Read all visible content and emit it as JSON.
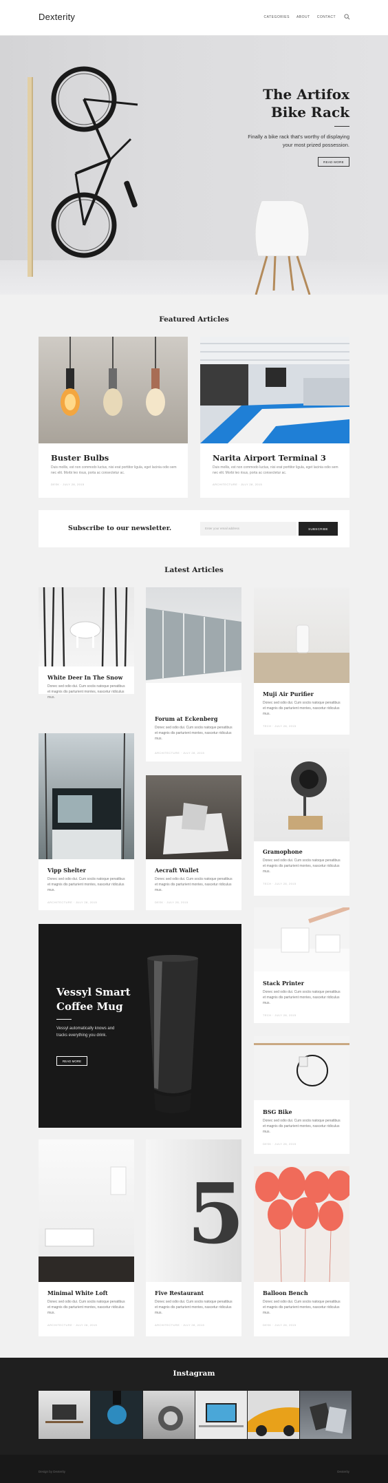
{
  "header": {
    "logo": "Dexterity",
    "nav": [
      "CATEGORIES",
      "ABOUT",
      "CONTACT"
    ]
  },
  "hero": {
    "title_line1": "The Artifox",
    "title_line2": "Bike Rack",
    "subtitle": "Finally a bike rack that's worthy of displaying your most prized possession.",
    "button": "READ MORE"
  },
  "featured": {
    "title": "Featured Articles",
    "cards": [
      {
        "title": "Buster Bulbs",
        "excerpt": "Duis mollis, est non commodo luctus, nisi erat porttitor ligula, eget lacinia odio sem nec elit. Morbi leo risus, porta ac consectetur ac.",
        "meta": "DESK  ·  JULY 28, 2015"
      },
      {
        "title": "Narita Airport Terminal 3",
        "excerpt": "Duis mollis, est non commodo luctus, nisi erat porttitor ligula, eget lacinia odio sem nec elit. Morbi leo risus, porta ac consectetur ac.",
        "meta": "ARCHITECTURE  ·  JULY 28, 2015"
      }
    ]
  },
  "newsletter": {
    "title": "Subscribe to our newsletter.",
    "placeholder": "Enter your email address",
    "button": "SUBSCRIBE"
  },
  "latest": {
    "title": "Latest Articles",
    "excerpt": "Donec sed odio dui. Cum sociis natoque penatibus et magnis dis parturient montes, nascetur ridiculus mus.",
    "cards": [
      {
        "title": "White Deer In The Snow",
        "meta": "PHOTOGRAPHY  ·  JULY 28, 2015"
      },
      {
        "title": "Forum at Eckenberg",
        "meta": "ARCHITECTURE  ·  JULY 28, 2015"
      },
      {
        "title": "Muji Air Purifier",
        "meta": "TECH  ·  JULY 28, 2015"
      },
      {
        "title": "Vipp Shelter",
        "meta": "ARCHITECTURE  ·  JULY 28, 2015"
      },
      {
        "title": "Aecraft Wallet",
        "meta": "DESK  ·  JULY 28, 2015"
      },
      {
        "title": "Gramophone",
        "meta": "TECH  ·  JULY 28, 2015"
      },
      {
        "title": "Stack Printer",
        "meta": "TECH  ·  JULY 28, 2015"
      },
      {
        "title": "BSG Bike",
        "meta": "DESK  ·  JULY 28, 2015"
      },
      {
        "title": "Minimal White Loft",
        "meta": "ARCHITECTURE  ·  JULY 28, 2015"
      },
      {
        "title": "Five Restaurant",
        "meta": "ARCHITECTURE  ·  JULY 28, 2015"
      },
      {
        "title": "Balloon Bench",
        "meta": "DESK  ·  JULY 28, 2015"
      }
    ]
  },
  "promo": {
    "title_line1": "Vessyl Smart",
    "title_line2": "Coffee Mug",
    "subtitle": "Vessyl automatically knows and tracks everything you drink.",
    "button": "READ MORE"
  },
  "instagram": {
    "title": "Instagram"
  },
  "footer": {
    "left": "Design by Dexterity",
    "right": "Dexterity"
  },
  "colors": {
    "background": "#f1f1f1",
    "dark": "#1f1f1f",
    "accent": "#222222"
  }
}
